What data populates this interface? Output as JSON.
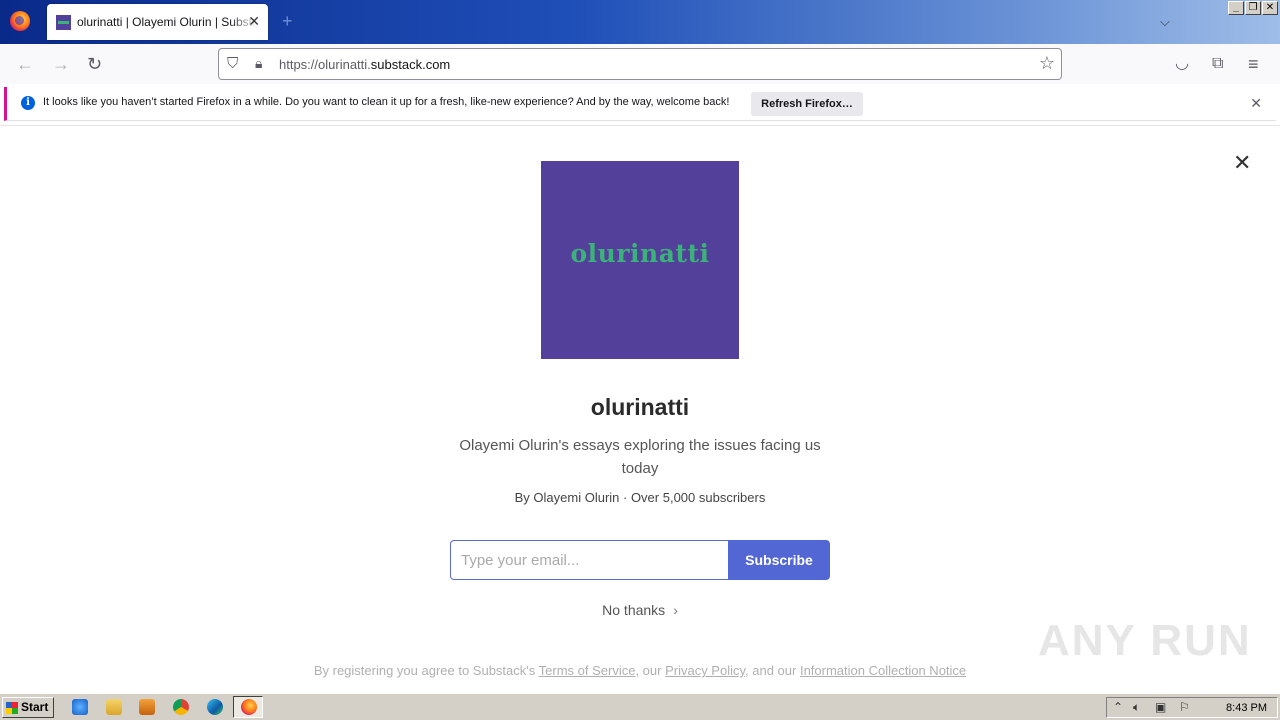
{
  "browser": {
    "tab": {
      "title": "olurinatti | Olayemi Olurin | Substack"
    },
    "url": {
      "prefix": "https://olurinatti.",
      "domain": "substack.com"
    },
    "notification": {
      "message": "It looks like you haven’t started Firefox in a while. Do you want to clean it up for a fresh, like-new experience? And by the way, welcome back!",
      "button_label": "Refresh Firefox…"
    }
  },
  "page": {
    "logo_text": "olurinatti",
    "title": "olurinatti",
    "description": "Olayemi Olurin's essays exploring the issues facing us today",
    "meta": "By Olayemi Olurin · Over 5,000 subscribers",
    "email_placeholder": "Type your email...",
    "subscribe_label": "Subscribe",
    "no_thanks_label": "No thanks",
    "legal": {
      "prefix": "By registering you agree to Substack's ",
      "terms": "Terms of Service",
      "sep1": ", our ",
      "privacy": "Privacy Policy",
      "sep2": ", and our ",
      "info": "Information Collection Notice"
    }
  },
  "watermark": "ANY RUN",
  "taskbar": {
    "start_label": "Start",
    "clock": "8:43 PM"
  },
  "colors": {
    "logo_bg": "#53409a",
    "logo_text": "#3bb27a",
    "subscribe_bg": "#5267d3",
    "notification_accent": "#d4148e"
  }
}
